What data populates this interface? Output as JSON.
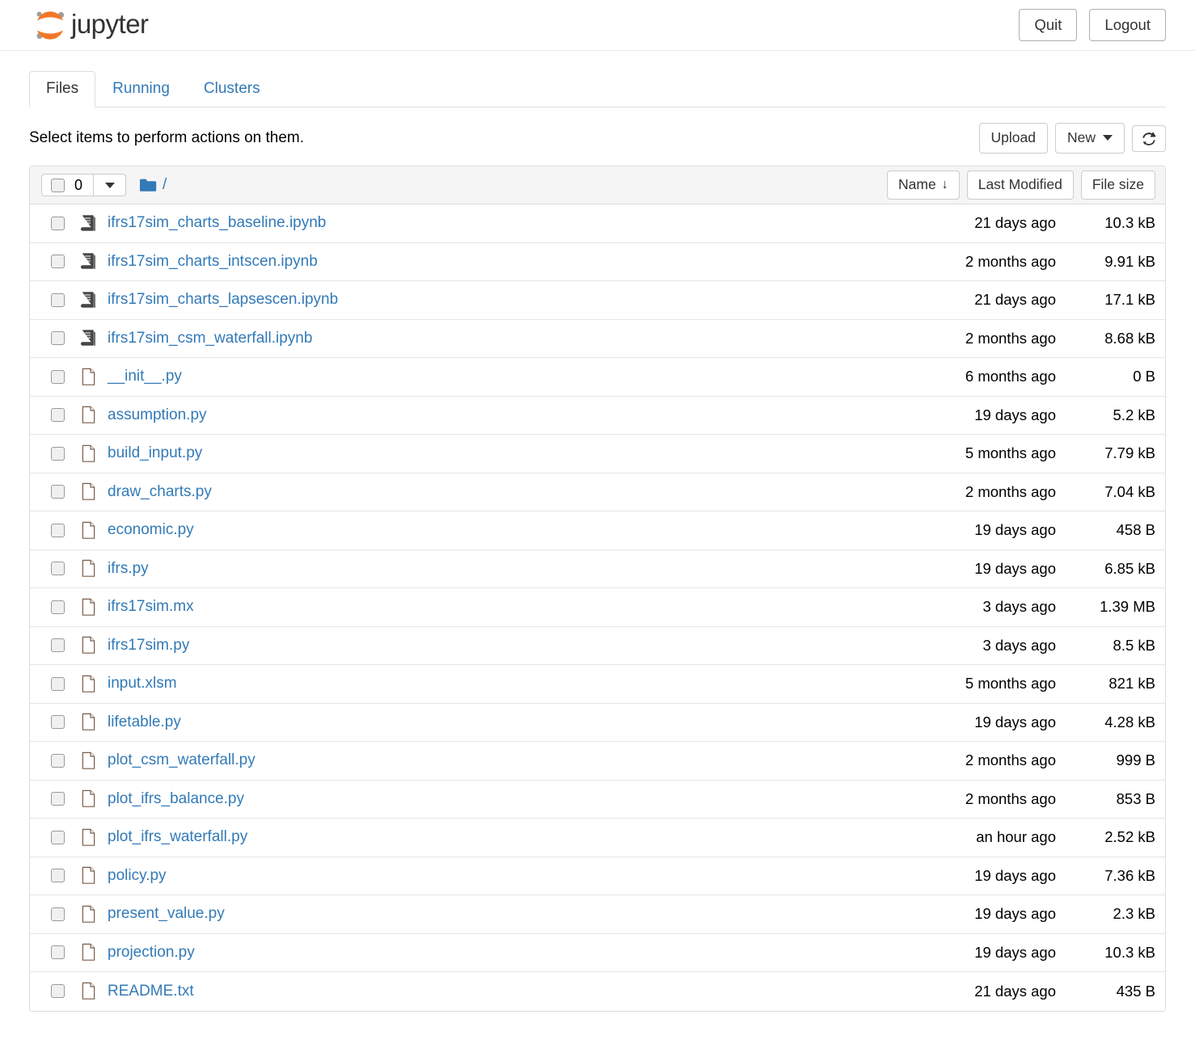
{
  "header": {
    "brand_text": "jupyter",
    "logo_icon": "jupyter-logo",
    "quit_label": "Quit",
    "logout_label": "Logout"
  },
  "tabs": [
    {
      "label": "Files",
      "active": true
    },
    {
      "label": "Running",
      "active": false
    },
    {
      "label": "Clusters",
      "active": false
    }
  ],
  "toolbar": {
    "message": "Select items to perform actions on them.",
    "upload_label": "Upload",
    "new_label": "New",
    "new_caret_icon": "chevron-down-icon",
    "refresh_icon": "refresh-icon"
  },
  "list_header": {
    "selected_count": "0",
    "select_all_checkbox_icon": "checkbox-unchecked-icon",
    "select_caret_icon": "chevron-down-icon",
    "folder_icon": "folder-icon",
    "breadcrumb_path": "/",
    "sort_name_label": "Name",
    "sort_name_arrow": "↓",
    "sort_modified_label": "Last Modified",
    "sort_size_label": "File size"
  },
  "colors": {
    "link": "#337ab7",
    "brand_orange": "#f37726",
    "brand_gray": "#9e9e9e",
    "header_bg": "#f5f5f5",
    "border": "#dddddd"
  },
  "files": [
    {
      "name": "ifrs17sim_charts_baseline.ipynb",
      "icon": "notebook-icon",
      "modified": "21 days ago",
      "size": "10.3 kB"
    },
    {
      "name": "ifrs17sim_charts_intscen.ipynb",
      "icon": "notebook-icon",
      "modified": "2 months ago",
      "size": "9.91 kB"
    },
    {
      "name": "ifrs17sim_charts_lapsescen.ipynb",
      "icon": "notebook-icon",
      "modified": "21 days ago",
      "size": "17.1 kB"
    },
    {
      "name": "ifrs17sim_csm_waterfall.ipynb",
      "icon": "notebook-icon",
      "modified": "2 months ago",
      "size": "8.68 kB"
    },
    {
      "name": "__init__.py",
      "icon": "file-icon",
      "modified": "6 months ago",
      "size": "0 B"
    },
    {
      "name": "assumption.py",
      "icon": "file-icon",
      "modified": "19 days ago",
      "size": "5.2 kB"
    },
    {
      "name": "build_input.py",
      "icon": "file-icon",
      "modified": "5 months ago",
      "size": "7.79 kB"
    },
    {
      "name": "draw_charts.py",
      "icon": "file-icon",
      "modified": "2 months ago",
      "size": "7.04 kB"
    },
    {
      "name": "economic.py",
      "icon": "file-icon",
      "modified": "19 days ago",
      "size": "458 B"
    },
    {
      "name": "ifrs.py",
      "icon": "file-icon",
      "modified": "19 days ago",
      "size": "6.85 kB"
    },
    {
      "name": "ifrs17sim.mx",
      "icon": "file-icon",
      "modified": "3 days ago",
      "size": "1.39 MB"
    },
    {
      "name": "ifrs17sim.py",
      "icon": "file-icon",
      "modified": "3 days ago",
      "size": "8.5 kB"
    },
    {
      "name": "input.xlsm",
      "icon": "file-icon",
      "modified": "5 months ago",
      "size": "821 kB"
    },
    {
      "name": "lifetable.py",
      "icon": "file-icon",
      "modified": "19 days ago",
      "size": "4.28 kB"
    },
    {
      "name": "plot_csm_waterfall.py",
      "icon": "file-icon",
      "modified": "2 months ago",
      "size": "999 B"
    },
    {
      "name": "plot_ifrs_balance.py",
      "icon": "file-icon",
      "modified": "2 months ago",
      "size": "853 B"
    },
    {
      "name": "plot_ifrs_waterfall.py",
      "icon": "file-icon",
      "modified": "an hour ago",
      "size": "2.52 kB"
    },
    {
      "name": "policy.py",
      "icon": "file-icon",
      "modified": "19 days ago",
      "size": "7.36 kB"
    },
    {
      "name": "present_value.py",
      "icon": "file-icon",
      "modified": "19 days ago",
      "size": "2.3 kB"
    },
    {
      "name": "projection.py",
      "icon": "file-icon",
      "modified": "19 days ago",
      "size": "10.3 kB"
    },
    {
      "name": "README.txt",
      "icon": "file-icon",
      "modified": "21 days ago",
      "size": "435 B"
    }
  ]
}
